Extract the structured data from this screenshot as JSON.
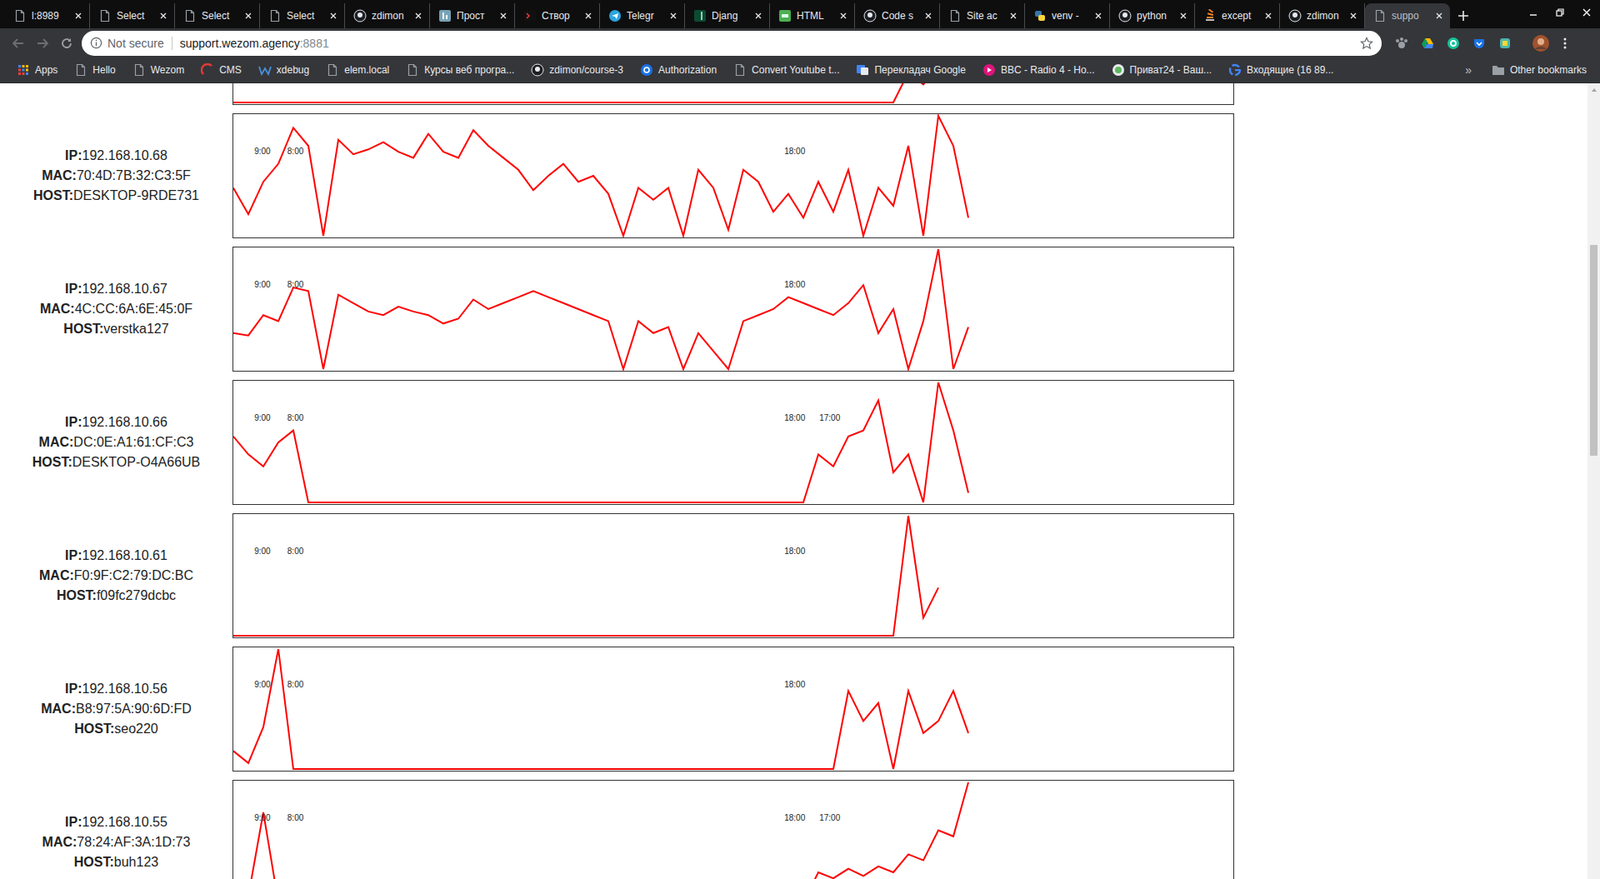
{
  "browser": {
    "tabs": [
      {
        "label": "l:8989",
        "kind": "doc",
        "selected": false
      },
      {
        "label": "Select",
        "kind": "doc",
        "selected": false
      },
      {
        "label": "Select",
        "kind": "doc",
        "selected": false
      },
      {
        "label": "Select",
        "kind": "doc",
        "selected": false
      },
      {
        "label": "zdimon",
        "kind": "github",
        "selected": false
      },
      {
        "label": "Прост",
        "kind": "habr",
        "selected": false
      },
      {
        "label": "Створ",
        "kind": "terminal",
        "selected": false
      },
      {
        "label": "Telegr",
        "kind": "telegram",
        "selected": false
      },
      {
        "label": "Djang",
        "kind": "django",
        "selected": false
      },
      {
        "label": "HTML",
        "kind": "html",
        "selected": false
      },
      {
        "label": "Code s",
        "kind": "github",
        "selected": false
      },
      {
        "label": "Site ac",
        "kind": "doc",
        "selected": false
      },
      {
        "label": "venv -",
        "kind": "python",
        "selected": false
      },
      {
        "label": "python",
        "kind": "github",
        "selected": false
      },
      {
        "label": "except",
        "kind": "stack",
        "selected": false
      },
      {
        "label": "zdimon",
        "kind": "github",
        "selected": false
      },
      {
        "label": "suppo",
        "kind": "doc",
        "selected": true
      }
    ],
    "address_bar": {
      "security": "Not secure",
      "host": "support.wezom.agency",
      "port": ":8881"
    },
    "bookmarks": [
      {
        "label": "Apps",
        "kind": "apps"
      },
      {
        "label": "Hello",
        "kind": "doc"
      },
      {
        "label": "Wezom",
        "kind": "doc"
      },
      {
        "label": "CMS",
        "kind": "cms"
      },
      {
        "label": "xdebug",
        "kind": "xdebug"
      },
      {
        "label": "elem.local",
        "kind": "doc"
      },
      {
        "label": "Курсы веб програ...",
        "kind": "doc"
      },
      {
        "label": "zdimon/course-3",
        "kind": "github"
      },
      {
        "label": "Authorization",
        "kind": "auth"
      },
      {
        "label": "Convert Youtube t...",
        "kind": "doc"
      },
      {
        "label": "Перекладач Google",
        "kind": "translate"
      },
      {
        "label": "BBC - Radio 4 - Ho...",
        "kind": "bbc"
      },
      {
        "label": "Приват24 - Ваш...",
        "kind": "privat"
      },
      {
        "label": "Входящие (16 89...",
        "kind": "google"
      }
    ],
    "bookmarks_more": "»",
    "other_bookmarks": "Other bookmarks"
  },
  "scrollbar": {
    "level": 0.19
  },
  "page": {
    "field_labels": {
      "ip": "IP:",
      "mac": "MAC:",
      "host": "HOST:"
    },
    "clipped_chart": {
      "values": [
        0,
        0,
        0,
        0,
        0,
        0,
        0,
        0,
        0,
        0,
        0,
        0,
        0,
        0,
        0,
        0,
        0,
        0,
        0,
        0,
        0,
        0,
        0,
        0,
        0,
        0,
        0,
        0,
        0,
        0,
        0,
        0,
        0,
        0,
        0,
        0,
        0,
        0,
        0,
        0,
        0,
        0,
        0,
        0,
        0,
        25,
        15,
        30
      ]
    },
    "hosts": [
      {
        "ip": "192.168.10.68",
        "mac": "70:4D:7B:32:C3:5F",
        "host": "DESKTOP-9RDE731",
        "ticks": [
          "9:00",
          "8:00",
          "18:00"
        ],
        "values": [
          40,
          18,
          45,
          60,
          90,
          75,
          0,
          80,
          68,
          72,
          78,
          70,
          65,
          85,
          70,
          65,
          88,
          75,
          65,
          55,
          38,
          50,
          60,
          45,
          50,
          35,
          0,
          40,
          30,
          40,
          0,
          55,
          40,
          5,
          55,
          45,
          20,
          35,
          15,
          45,
          20,
          55,
          0,
          40,
          25,
          75,
          0,
          100,
          75,
          15
        ]
      },
      {
        "ip": "192.168.10.67",
        "mac": "4C:CC:6A:6E:45:0F",
        "host": "verstka127",
        "ticks": [
          "9:00",
          "8:00",
          "18:00"
        ],
        "values": [
          30,
          28,
          45,
          40,
          68,
          65,
          0,
          62,
          55,
          48,
          45,
          52,
          48,
          45,
          38,
          42,
          58,
          50,
          55,
          60,
          65,
          60,
          55,
          50,
          45,
          40,
          0,
          40,
          30,
          35,
          0,
          30,
          15,
          0,
          40,
          45,
          50,
          60,
          55,
          50,
          45,
          55,
          70,
          30,
          50,
          0,
          40,
          100,
          0,
          35
        ]
      },
      {
        "ip": "192.168.10.66",
        "mac": "DC:0E:A1:61:CF:C3",
        "host": "DESKTOP-O4A66UB",
        "ticks": [
          "9:00",
          "8:00",
          "18:00",
          "17:00"
        ],
        "values": [
          55,
          40,
          30,
          50,
          60,
          0,
          0,
          0,
          0,
          0,
          0,
          0,
          0,
          0,
          0,
          0,
          0,
          0,
          0,
          0,
          0,
          0,
          0,
          0,
          0,
          0,
          0,
          0,
          0,
          0,
          0,
          0,
          0,
          0,
          0,
          0,
          0,
          0,
          0,
          40,
          30,
          55,
          60,
          85,
          25,
          40,
          0,
          100,
          60,
          8
        ]
      },
      {
        "ip": "192.168.10.61",
        "mac": "F0:9F:C2:79:DC:BC",
        "host": "f09fc279dcbc",
        "ticks": [
          "9:00",
          "8:00",
          "18:00"
        ],
        "values": [
          0,
          0,
          0,
          0,
          0,
          0,
          0,
          0,
          0,
          0,
          0,
          0,
          0,
          0,
          0,
          0,
          0,
          0,
          0,
          0,
          0,
          0,
          0,
          0,
          0,
          0,
          0,
          0,
          0,
          0,
          0,
          0,
          0,
          0,
          0,
          0,
          0,
          0,
          0,
          0,
          0,
          0,
          0,
          0,
          0,
          100,
          15,
          40
        ]
      },
      {
        "ip": "192.168.10.56",
        "mac": "B8:97:5A:90:6D:FD",
        "host": "seo220",
        "ticks": [
          "9:00",
          "8:00",
          "18:00"
        ],
        "values": [
          15,
          5,
          35,
          100,
          0,
          0,
          0,
          0,
          0,
          0,
          0,
          0,
          0,
          0,
          0,
          0,
          0,
          0,
          0,
          0,
          0,
          0,
          0,
          0,
          0,
          0,
          0,
          0,
          0,
          0,
          0,
          0,
          0,
          0,
          0,
          0,
          0,
          0,
          0,
          0,
          0,
          65,
          40,
          55,
          0,
          65,
          30,
          40,
          65,
          30
        ]
      },
      {
        "ip": "192.168.10.55",
        "mac": "78:24:AF:3A:1D:73",
        "host": "buh123",
        "ticks": [
          "9:00",
          "8:00",
          "18:00",
          "17:00"
        ],
        "values": [
          10,
          5,
          75,
          0,
          0,
          0,
          0,
          0,
          0,
          0,
          0,
          0,
          0,
          0,
          0,
          0,
          0,
          0,
          0,
          0,
          0,
          0,
          0,
          0,
          0,
          0,
          0,
          0,
          0,
          0,
          0,
          0,
          0,
          0,
          0,
          0,
          0,
          0,
          0,
          25,
          20,
          28,
          22,
          30,
          25,
          40,
          35,
          60,
          55,
          100
        ]
      }
    ]
  }
}
